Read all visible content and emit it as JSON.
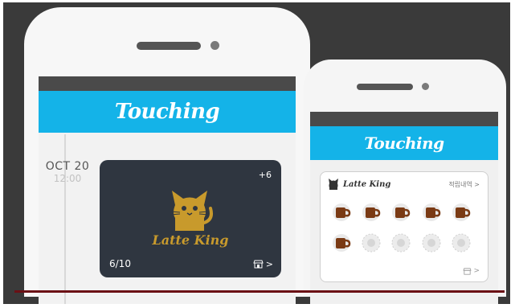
{
  "promo": {
    "left_phone": {
      "app_title": "Touching",
      "timeline_date": "OCT 20",
      "timeline_time": "12:00",
      "card": {
        "brand": "Latte King",
        "bonus": "+6",
        "progress": "6/10",
        "stamps_earned": 6,
        "stamps_total": 10,
        "store_chevron": ">"
      }
    },
    "right_phone": {
      "app_title": "Touching",
      "card": {
        "brand": "Latte King",
        "history_link": "적립내역 >",
        "filled_stamps": 6,
        "empty_stamps": 4,
        "store_chevron": ">"
      }
    },
    "colors": {
      "app_bar": "#14b3e8",
      "card_dark": "#2f3640",
      "brand_gold": "#c89a2c",
      "stamp_brown": "#7a3a14"
    }
  }
}
